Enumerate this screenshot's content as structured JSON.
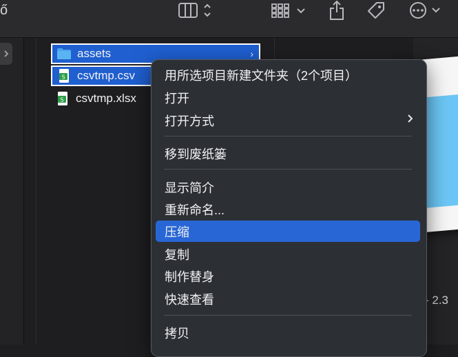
{
  "toolbar": {
    "app_glyph": "ő",
    "icons": [
      "column-view-icon",
      "view-toggle-icon",
      "group-grid-icon",
      "share-icon",
      "tag-icon",
      "more-options-icon"
    ]
  },
  "files": [
    {
      "name": "assets",
      "icon": "folder-icon",
      "selected": true,
      "has_children": true
    },
    {
      "name": "csvtmp.csv",
      "icon": "spreadsheet-file-icon",
      "selected": true
    },
    {
      "name": "csvtmp.xlsx",
      "icon": "spreadsheet-file-icon",
      "selected": false
    }
  ],
  "context_menu": {
    "items": [
      {
        "label": "用所选项目新建文件夹（2个项目）"
      },
      {
        "label": "打开"
      },
      {
        "label": "打开方式",
        "submenu": true
      },
      {
        "label": "移到废纸篓"
      },
      {
        "label": "显示简介"
      },
      {
        "label": "重新命名..."
      },
      {
        "label": "压缩",
        "highlighted": true
      },
      {
        "label": "复制"
      },
      {
        "label": "制作替身"
      },
      {
        "label": "快速查看"
      },
      {
        "label": "拷贝"
      }
    ],
    "submenu_arrow": "›"
  },
  "preview": {
    "caption": "- 2.3"
  },
  "colors": {
    "selection": "#1f5fd0",
    "highlight": "#2866d6",
    "menu_bg": "#2c3035"
  }
}
